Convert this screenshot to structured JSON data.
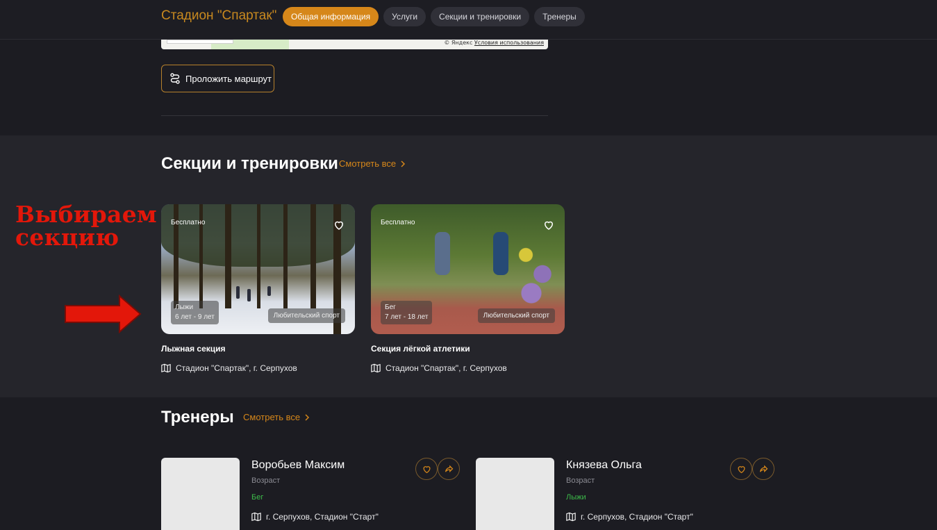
{
  "header": {
    "site_title": "Стадион \"Спартак\"",
    "tabs": [
      {
        "label": "Общая информация",
        "active": true
      },
      {
        "label": "Услуги",
        "active": false
      },
      {
        "label": "Секции и тренировки",
        "active": false
      },
      {
        "label": "Тренеры",
        "active": false
      }
    ]
  },
  "map": {
    "attribution_brand": "© Яндекс",
    "attribution_terms": "Условия использования"
  },
  "route_button": {
    "label": "Проложить маршрут",
    "icon": "route-icon"
  },
  "sections": {
    "title": "Секции и тренировки",
    "see_all": "Смотреть все",
    "cards": [
      {
        "price_badge": "Бесплатно",
        "sport": "Лыжи",
        "age_range": "6 лет - 9 лет",
        "level": "Любительский спорт",
        "name": "Лыжная секция",
        "location": "Стадион \"Спартак\", г. Серпухов"
      },
      {
        "price_badge": "Бесплатно",
        "sport": "Бег",
        "age_range": "7 лет - 18 лет",
        "level": "Любительский спорт",
        "name": "Секция лёгкой атлетики",
        "location": "Стадион \"Спартак\", г. Серпухов"
      }
    ]
  },
  "annotation": {
    "line1": "Выбираем",
    "line2": "секцию",
    "color": "#e3170a"
  },
  "trainers": {
    "title": "Тренеры",
    "see_all": "Смотреть все",
    "items": [
      {
        "name": "Воробьев Максим",
        "age_label": "Возраст",
        "sport": "Бег",
        "location": "г. Серпухов, Стадион \"Старт\""
      },
      {
        "name": "Князева Ольга",
        "age_label": "Возраст",
        "sport": "Лыжи",
        "location": "г. Серпухов, Стадион \"Старт\""
      }
    ]
  },
  "colors": {
    "accent": "#d6871a",
    "sport_green": "#3dbb4a",
    "background": "#1c1c22"
  }
}
